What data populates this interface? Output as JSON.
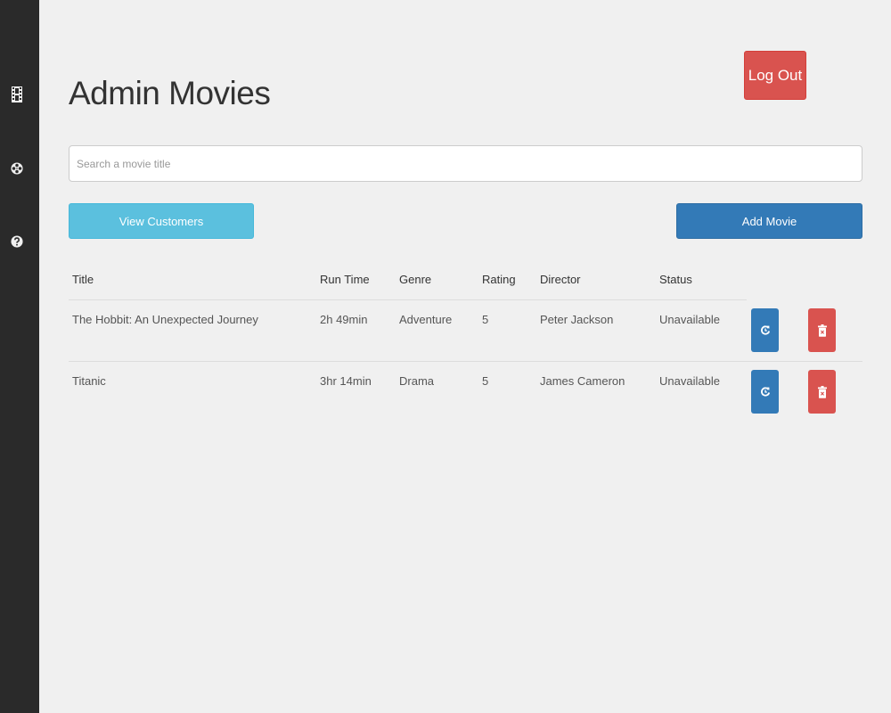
{
  "sidebar": {
    "items": [
      {
        "icon": "film-icon"
      },
      {
        "icon": "film-reel-icon"
      },
      {
        "icon": "help-icon"
      }
    ]
  },
  "header": {
    "title": "Admin Movies",
    "logout_label": "Log Out"
  },
  "search": {
    "placeholder": "Search a movie title",
    "value": ""
  },
  "actions": {
    "view_customers_label": "View Customers",
    "add_movie_label": "Add Movie"
  },
  "table": {
    "columns": [
      "Title",
      "Run Time",
      "Genre",
      "Rating",
      "Director",
      "Status"
    ],
    "rows": [
      {
        "title": "The Hobbit: An Unexpected Journey",
        "run_time": "2h 49min",
        "genre": "Adventure",
        "rating": "5",
        "director": "Peter Jackson",
        "status": "Unavailable"
      },
      {
        "title": "Titanic",
        "run_time": "3hr 14min",
        "genre": "Drama",
        "rating": "5",
        "director": "James Cameron",
        "status": "Unavailable"
      }
    ]
  },
  "colors": {
    "sidebar": "#2a2a2a",
    "danger": "#d9534f",
    "info": "#5bc0de",
    "primary": "#337ab7",
    "background": "#f0f0f0"
  }
}
